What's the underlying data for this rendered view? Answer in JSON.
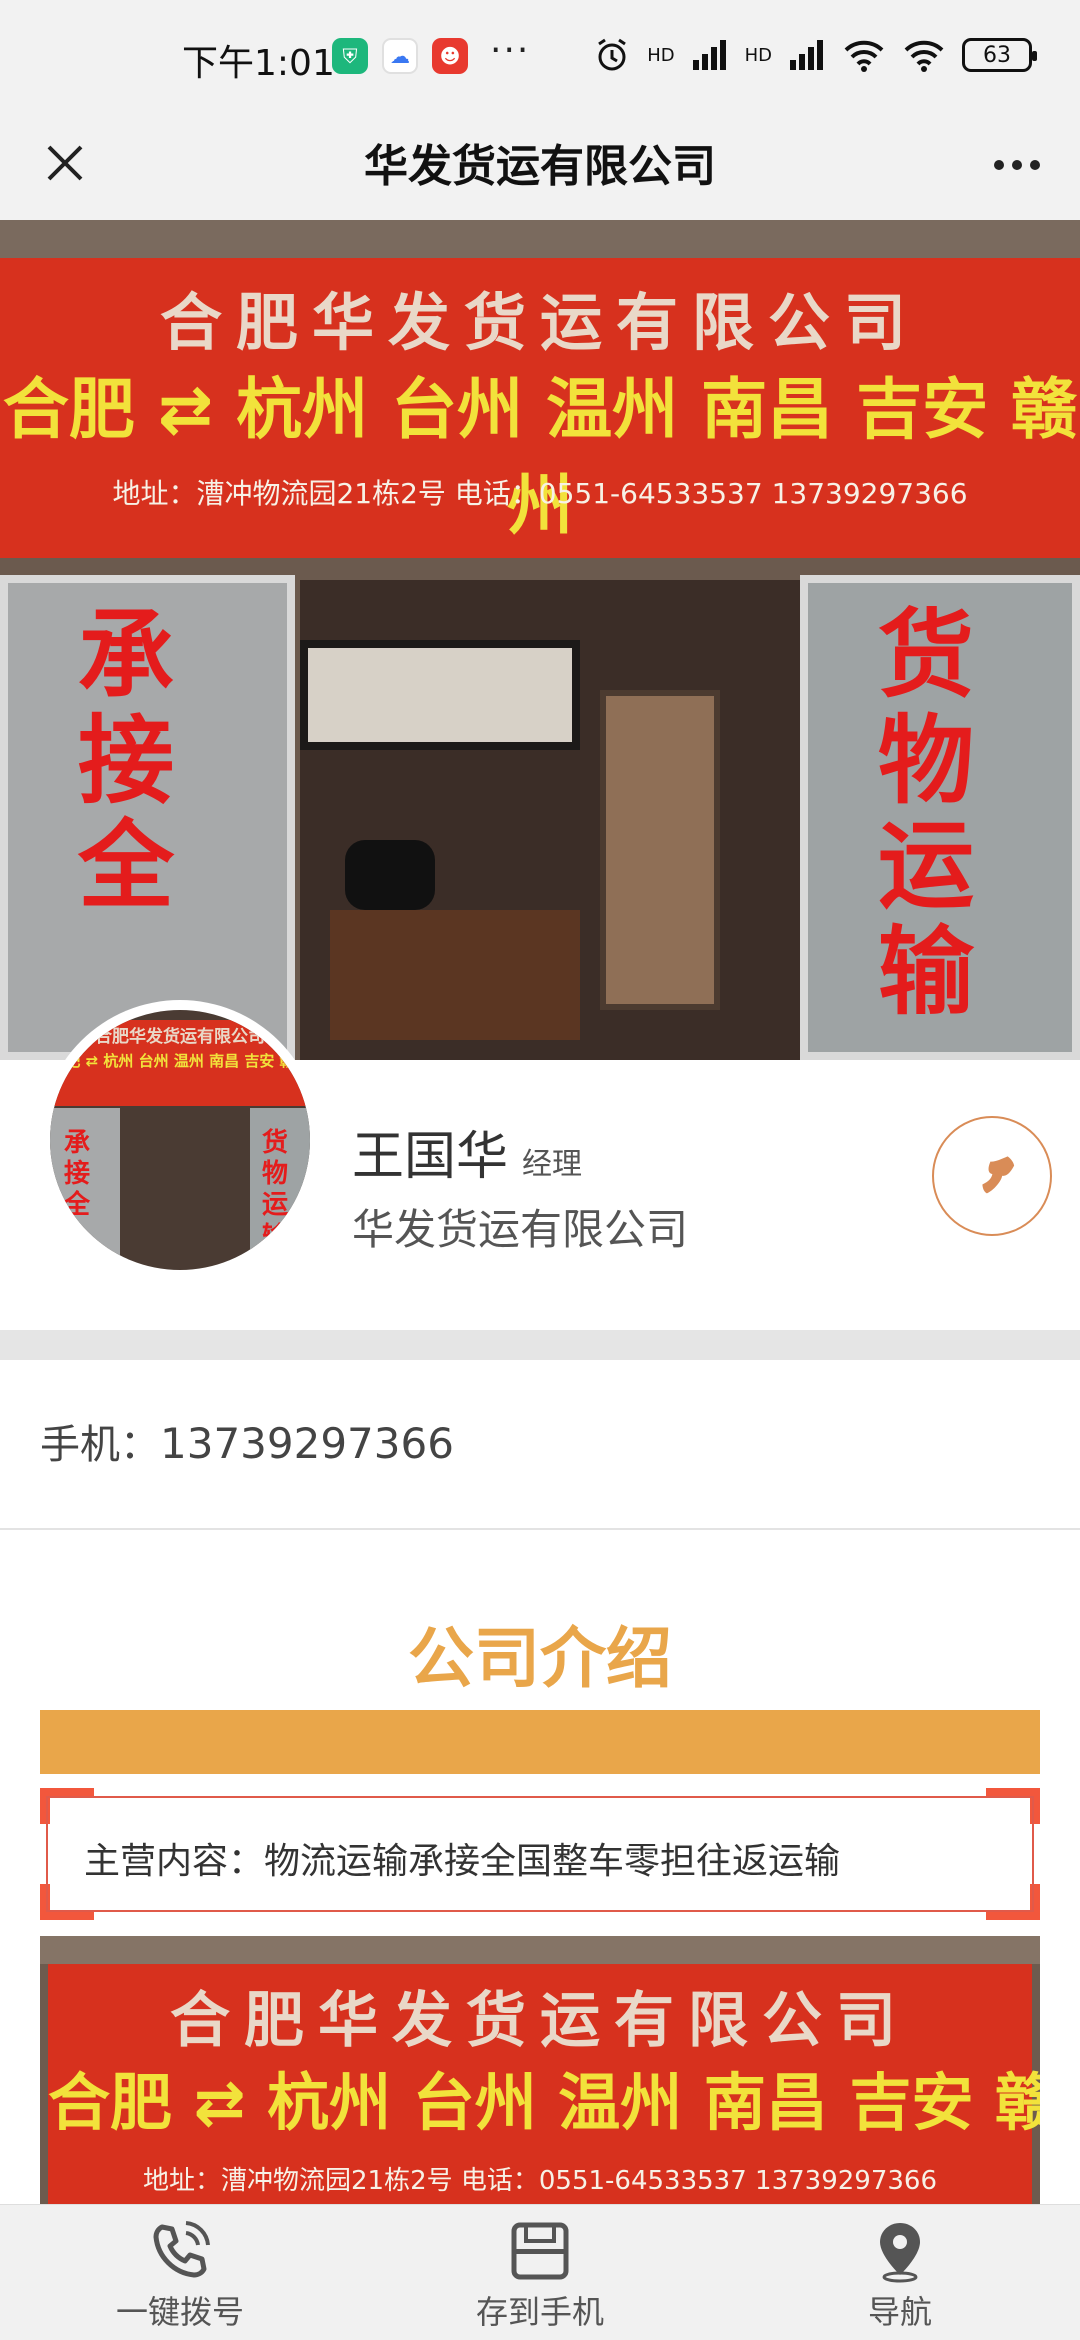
{
  "status_bar": {
    "time": "下午1:01",
    "more": "···",
    "network_label_1": "HD",
    "network_label_2": "HD",
    "battery": "63"
  },
  "header": {
    "title": "华发货运有限公司",
    "close_icon": "close-icon",
    "menu_icon": "more-dots-icon"
  },
  "hero": {
    "sign_line1": "合肥华发货运有限公司",
    "sign_line2": "合肥 ⇄ 杭州 台州 温州 南昌 吉安 赣州",
    "sign_line3": "地址：漕冲物流园21栋2号 电话：0551-64533537 13739297366",
    "door_left_text": "承接全",
    "door_right_text": "货物运输"
  },
  "profile": {
    "name": "王国华",
    "title": "经理",
    "company": "华发货运有限公司",
    "call_icon": "phone-icon"
  },
  "contact": {
    "mobile_label": "手机：",
    "mobile_value": "13739297366"
  },
  "intro": {
    "title": "公司介绍",
    "business": "主营内容：物流运输承接全国整车零担往返运输"
  },
  "photo2": {
    "sign_line1": "合肥华发货运有限公司",
    "sign_line2": "合肥 ⇄ 杭州 台州 温州 南昌 吉安 赣州",
    "sign_line3": "地址：漕冲物流园21栋2号 电话：0551-64533537 13739297366"
  },
  "bottom_nav": [
    {
      "label": "一键拨号",
      "icon": "phone-call-icon"
    },
    {
      "label": "存到手机",
      "icon": "save-icon"
    },
    {
      "label": "导航",
      "icon": "location-pin-icon"
    }
  ],
  "colors": {
    "accent_orange": "#e9a64a",
    "call_orange": "#d98c57",
    "sign_red": "#d7311e",
    "corner_red": "#f2573c"
  }
}
